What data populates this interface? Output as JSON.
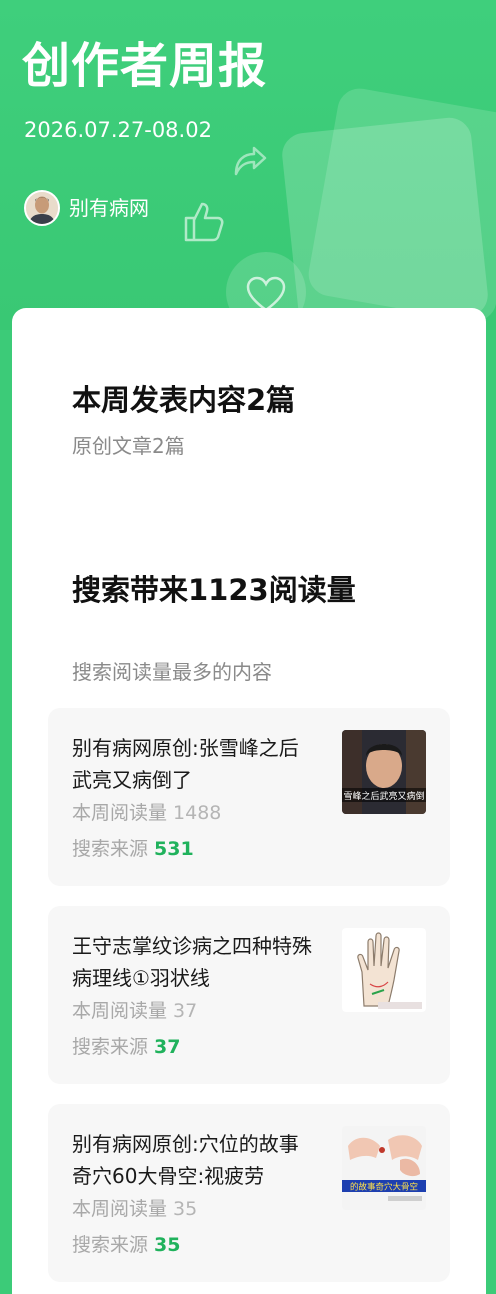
{
  "header": {
    "title": "创作者周报",
    "date_range": "2026.07.27-08.02",
    "author_name": "别有病网"
  },
  "publish": {
    "title": "本周发表内容2篇",
    "subtitle": "原创文章2篇"
  },
  "search": {
    "title": "搜索带来1123阅读量",
    "subtitle": "搜索阅读量最多的内容",
    "items": [
      {
        "title": "别有病网原创:张雪峰之后武亮又病倒了",
        "weekly_reads_label": "本周阅读量",
        "weekly_reads": "1488",
        "search_source_label": "搜索来源",
        "search_source": "531",
        "thumb_caption": "雪峰之后武亮又病倒"
      },
      {
        "title": "王守志掌纹诊病之四种特殊病理线①羽状线",
        "weekly_reads_label": "本周阅读量",
        "weekly_reads": "37",
        "search_source_label": "搜索来源",
        "search_source": "37",
        "thumb_caption": ""
      },
      {
        "title": "别有病网原创:穴位的故事奇穴60大骨空:视疲劳",
        "weekly_reads_label": "本周阅读量",
        "weekly_reads": "35",
        "search_source_label": "搜索来源",
        "search_source": "35",
        "thumb_caption": "的故事奇穴大骨空"
      }
    ]
  },
  "colors": {
    "brand_green": "#3ccb78",
    "accent_green": "#20b25c",
    "card_bg": "#ffffff",
    "item_bg": "#f7f7f7"
  }
}
